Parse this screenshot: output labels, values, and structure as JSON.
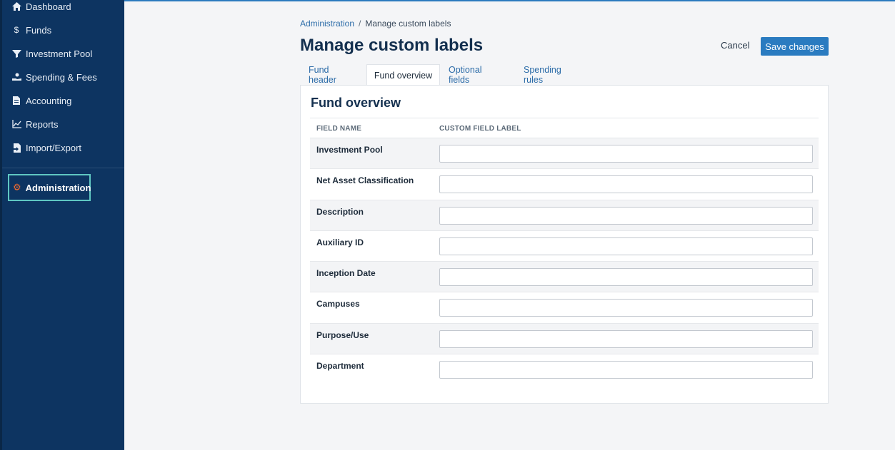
{
  "sidebar": {
    "items": [
      {
        "label": "Dashboard",
        "icon": "home-icon"
      },
      {
        "label": "Funds",
        "icon": "dollar-icon"
      },
      {
        "label": "Investment Pool",
        "icon": "pool-icon"
      },
      {
        "label": "Spending & Fees",
        "icon": "hand-coin-icon"
      },
      {
        "label": "Accounting",
        "icon": "ledger-icon"
      },
      {
        "label": "Reports",
        "icon": "line-chart-icon"
      },
      {
        "label": "Import/Export",
        "icon": "import-export-icon"
      }
    ],
    "admin": {
      "label": "Administration",
      "icon": "gear-icon"
    }
  },
  "breadcrumb": {
    "parent": "Administration",
    "separator": "/",
    "current": "Manage custom labels"
  },
  "page": {
    "title": "Manage custom labels"
  },
  "actions": {
    "cancel": "Cancel",
    "save": "Save changes"
  },
  "tabs": [
    {
      "label": "Fund header"
    },
    {
      "label": "Fund overview"
    },
    {
      "label": "Optional fields"
    },
    {
      "label": "Spending rules"
    }
  ],
  "panel": {
    "title": "Fund overview",
    "columns": {
      "field_name": "FIELD NAME",
      "custom_label": "CUSTOM FIELD LABEL"
    },
    "rows": [
      {
        "field": "Investment Pool",
        "value": ""
      },
      {
        "field": "Net Asset Classification",
        "value": ""
      },
      {
        "field": "Description",
        "value": ""
      },
      {
        "field": "Auxiliary ID",
        "value": ""
      },
      {
        "field": "Inception Date",
        "value": ""
      },
      {
        "field": "Campuses",
        "value": ""
      },
      {
        "field": "Purpose/Use",
        "value": ""
      },
      {
        "field": "Department",
        "value": ""
      }
    ]
  },
  "colors": {
    "sidebar": "#0d3461",
    "accent": "#2a7bc0",
    "admin_focus": "#5fc7c2",
    "admin_icon": "#f26a2e"
  }
}
